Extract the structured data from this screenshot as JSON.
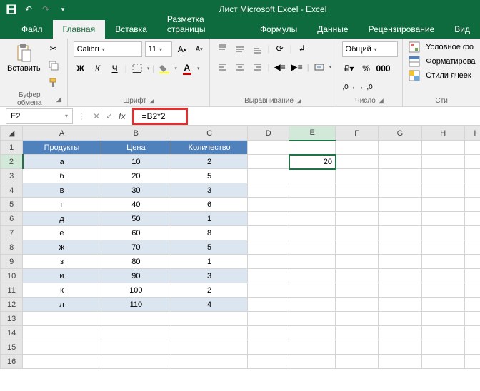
{
  "app": {
    "title": "Лист Microsoft Excel - Excel"
  },
  "qat": {
    "save": "💾",
    "undo": "↶",
    "redo": "↷",
    "more": "▾"
  },
  "tabs": {
    "file": "Файл",
    "home": "Главная",
    "insert": "Вставка",
    "layout": "Разметка страницы",
    "formulas": "Формулы",
    "data": "Данные",
    "review": "Рецензирование",
    "view": "Вид"
  },
  "ribbon": {
    "clipboard": {
      "paste": "Вставить",
      "label": "Буфер обмена"
    },
    "font": {
      "name": "Calibri",
      "size": "11",
      "label": "Шрифт",
      "bold": "Ж",
      "italic": "К",
      "underline": "Ч"
    },
    "align": {
      "label": "Выравнивание",
      "wrap": "↲"
    },
    "number": {
      "format": "Общий",
      "label": "Число"
    },
    "styles": {
      "cond": "Условное фо",
      "table": "Форматирова",
      "cell": "Стили ячеек",
      "label": "Сти"
    }
  },
  "formula_bar": {
    "cell_ref": "E2",
    "formula": "=B2*2"
  },
  "columns": [
    "A",
    "B",
    "C",
    "D",
    "E",
    "F",
    "G",
    "H",
    "I"
  ],
  "selected_col": "E",
  "selected_row": 2,
  "table": {
    "headers": {
      "a": "Продукты",
      "b": "Цена",
      "c": "Количество"
    },
    "rows": [
      {
        "a": "а",
        "b": "10",
        "c": "2"
      },
      {
        "a": "б",
        "b": "20",
        "c": "5"
      },
      {
        "a": "в",
        "b": "30",
        "c": "3"
      },
      {
        "a": "г",
        "b": "40",
        "c": "6"
      },
      {
        "a": "д",
        "b": "50",
        "c": "1"
      },
      {
        "a": "е",
        "b": "60",
        "c": "8"
      },
      {
        "a": "ж",
        "b": "70",
        "c": "5"
      },
      {
        "a": "з",
        "b": "80",
        "c": "1"
      },
      {
        "a": "и",
        "b": "90",
        "c": "3"
      },
      {
        "a": "к",
        "b": "100",
        "c": "2"
      },
      {
        "a": "л",
        "b": "110",
        "c": "4"
      }
    ]
  },
  "e2_value": "20",
  "total_rows": 16
}
